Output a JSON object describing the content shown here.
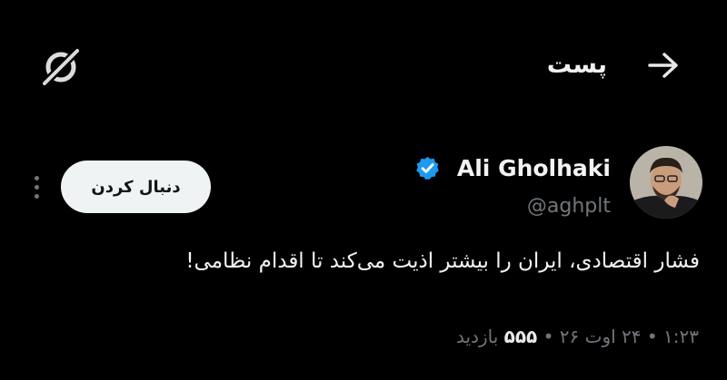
{
  "header": {
    "title": "پست"
  },
  "author": {
    "name": "Ali Gholhaki",
    "handle": "@aghplt",
    "verified": true
  },
  "actions": {
    "follow_label": "دنبال کردن"
  },
  "tweet": {
    "text": "فشار اقتصادی، ایران را بیشتر اذیت می‌کند تا اقدام نظامی!",
    "time": "۱:۲۳",
    "sep1": "•",
    "date": "۲۴ اوت ۲۶",
    "sep2": "•",
    "views_count": "۵۵۵",
    "views_label": "بازدید"
  },
  "colors": {
    "background": "#000000",
    "text": "#e7e9ea",
    "muted": "#71767b",
    "verified_blue": "#1d9bf0",
    "follow_bg": "#eff3f4"
  }
}
